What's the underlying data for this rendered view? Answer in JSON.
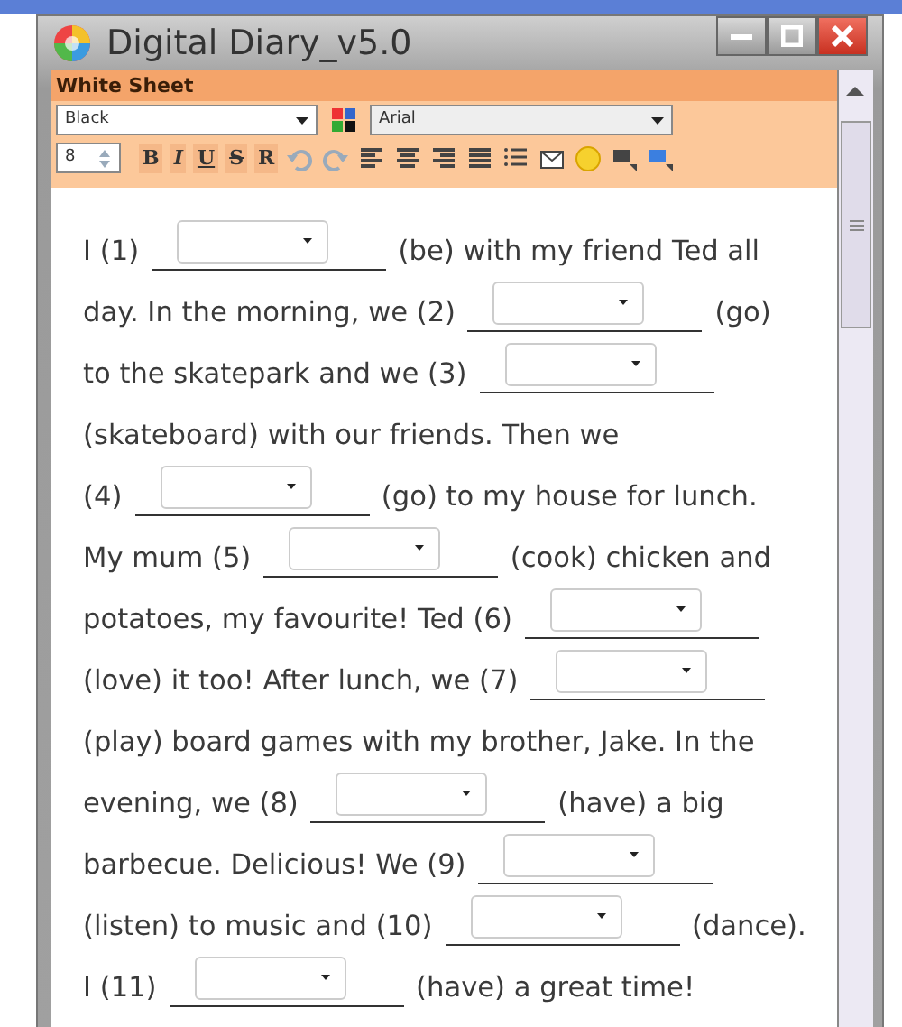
{
  "window": {
    "title": "Digital Diary_v5.0"
  },
  "sheet": {
    "title": "White Sheet"
  },
  "toolbar": {
    "color_select": "Black",
    "font_select": "Arial",
    "size": "8",
    "format_buttons": [
      {
        "label": "B",
        "kind": "bold"
      },
      {
        "label": "I",
        "kind": "italic"
      },
      {
        "label": "U",
        "kind": "underline"
      },
      {
        "label": "S",
        "kind": "strike"
      },
      {
        "label": "R",
        "kind": "plain"
      }
    ]
  },
  "text_lines": [
    [
      {
        "kind": "text",
        "text": "I (1)"
      },
      {
        "kind": "blank"
      },
      {
        "kind": "text",
        "text": "(be) with my friend Ted all"
      }
    ],
    [
      {
        "kind": "text",
        "text": "day. In the morning, we (2)"
      },
      {
        "kind": "blank"
      },
      {
        "kind": "text",
        "text": "(go)"
      }
    ],
    [
      {
        "kind": "text",
        "text": "to the skatepark and we (3)"
      },
      {
        "kind": "blank"
      }
    ],
    [
      {
        "kind": "text",
        "text": "(skateboard) with our friends. Then we"
      }
    ],
    [
      {
        "kind": "text",
        "text": "(4)"
      },
      {
        "kind": "blank"
      },
      {
        "kind": "text",
        "text": "(go) to my house for lunch."
      }
    ],
    [
      {
        "kind": "text",
        "text": "My mum (5)"
      },
      {
        "kind": "blank"
      },
      {
        "kind": "text",
        "text": "(cook) chicken and"
      }
    ],
    [
      {
        "kind": "text",
        "text": "potatoes, my favourite! Ted (6)"
      },
      {
        "kind": "blank"
      }
    ],
    [
      {
        "kind": "text",
        "text": "(love) it too! After lunch, we (7)"
      },
      {
        "kind": "blank"
      }
    ],
    [
      {
        "kind": "text",
        "text": "(play) board games with my brother, Jake. In the"
      }
    ],
    [
      {
        "kind": "text",
        "text": "evening, we (8)"
      },
      {
        "kind": "blank"
      },
      {
        "kind": "text",
        "text": "(have) a big"
      }
    ],
    [
      {
        "kind": "text",
        "text": "barbecue. Delicious! We (9)"
      },
      {
        "kind": "blank"
      }
    ],
    [
      {
        "kind": "text",
        "text": "(listen) to music and (10)"
      },
      {
        "kind": "blank"
      },
      {
        "kind": "text",
        "text": "(dance)."
      }
    ],
    [
      {
        "kind": "text",
        "text": "I (11)"
      },
      {
        "kind": "blank"
      },
      {
        "kind": "text",
        "text": "(have) a great time!"
      }
    ]
  ]
}
